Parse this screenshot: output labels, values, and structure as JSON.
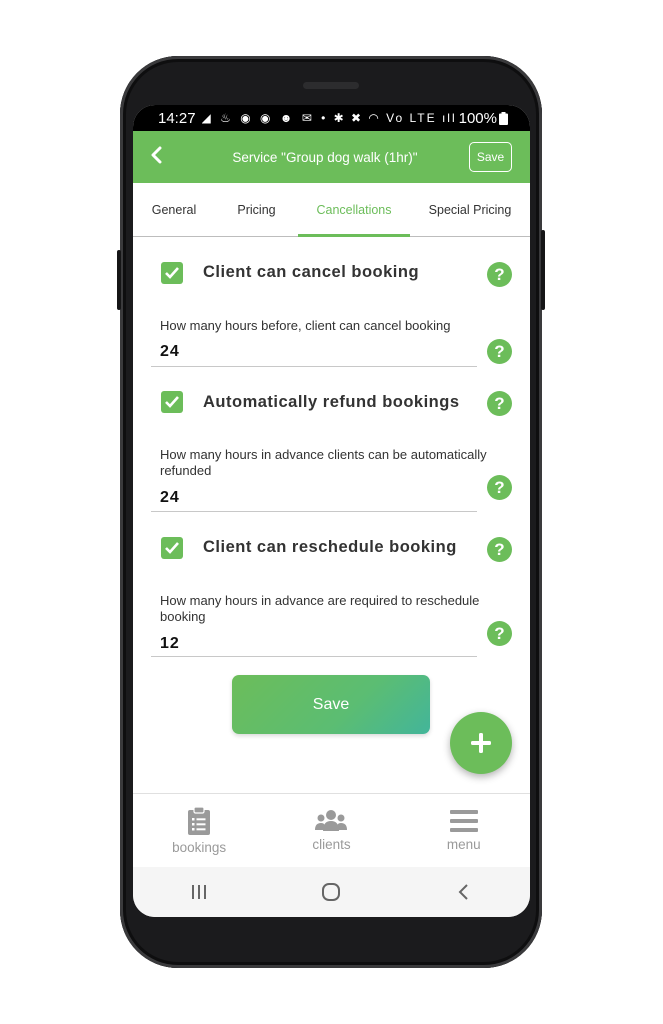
{
  "status_bar": {
    "time": "14:27",
    "left_icons": "◢ ♨ ◉ ◉ ☻ ✉ •",
    "right_icons": "✱ ✖ ◠ Vo LTE ıll",
    "battery": "100%"
  },
  "header": {
    "title": "Service \"Group dog walk (1hr)\"",
    "save_label": "Save",
    "back_icon": "chevron-left-icon"
  },
  "tabs": [
    {
      "label": "General"
    },
    {
      "label": "Pricing"
    },
    {
      "label": "Cancellations",
      "active": true
    },
    {
      "label": "Special Pricing"
    }
  ],
  "sections": [
    {
      "checkbox_label": "Client can cancel booking",
      "checked": true,
      "field_label": "How many hours before, client can cancel booking",
      "field_value": "24"
    },
    {
      "checkbox_label": "Automatically refund bookings",
      "checked": true,
      "field_label": "How many hours in advance clients can be automatically refunded",
      "field_value": "24"
    },
    {
      "checkbox_label": "Client can reschedule booking",
      "checked": true,
      "field_label": "How many hours in advance are required to reschedule booking",
      "field_value": "12"
    }
  ],
  "help_glyph": "?",
  "save_button": {
    "label": "Save"
  },
  "bottom_nav": [
    {
      "label": "bookings",
      "icon": "clipboard-icon"
    },
    {
      "label": "clients",
      "icon": "users-icon"
    },
    {
      "label": "menu",
      "icon": "hamburger-menu-icon"
    }
  ],
  "colors": {
    "brand_green": "#6cbd5a",
    "gradient_end": "#43b59a",
    "nav_gray": "#9a9a9a"
  }
}
